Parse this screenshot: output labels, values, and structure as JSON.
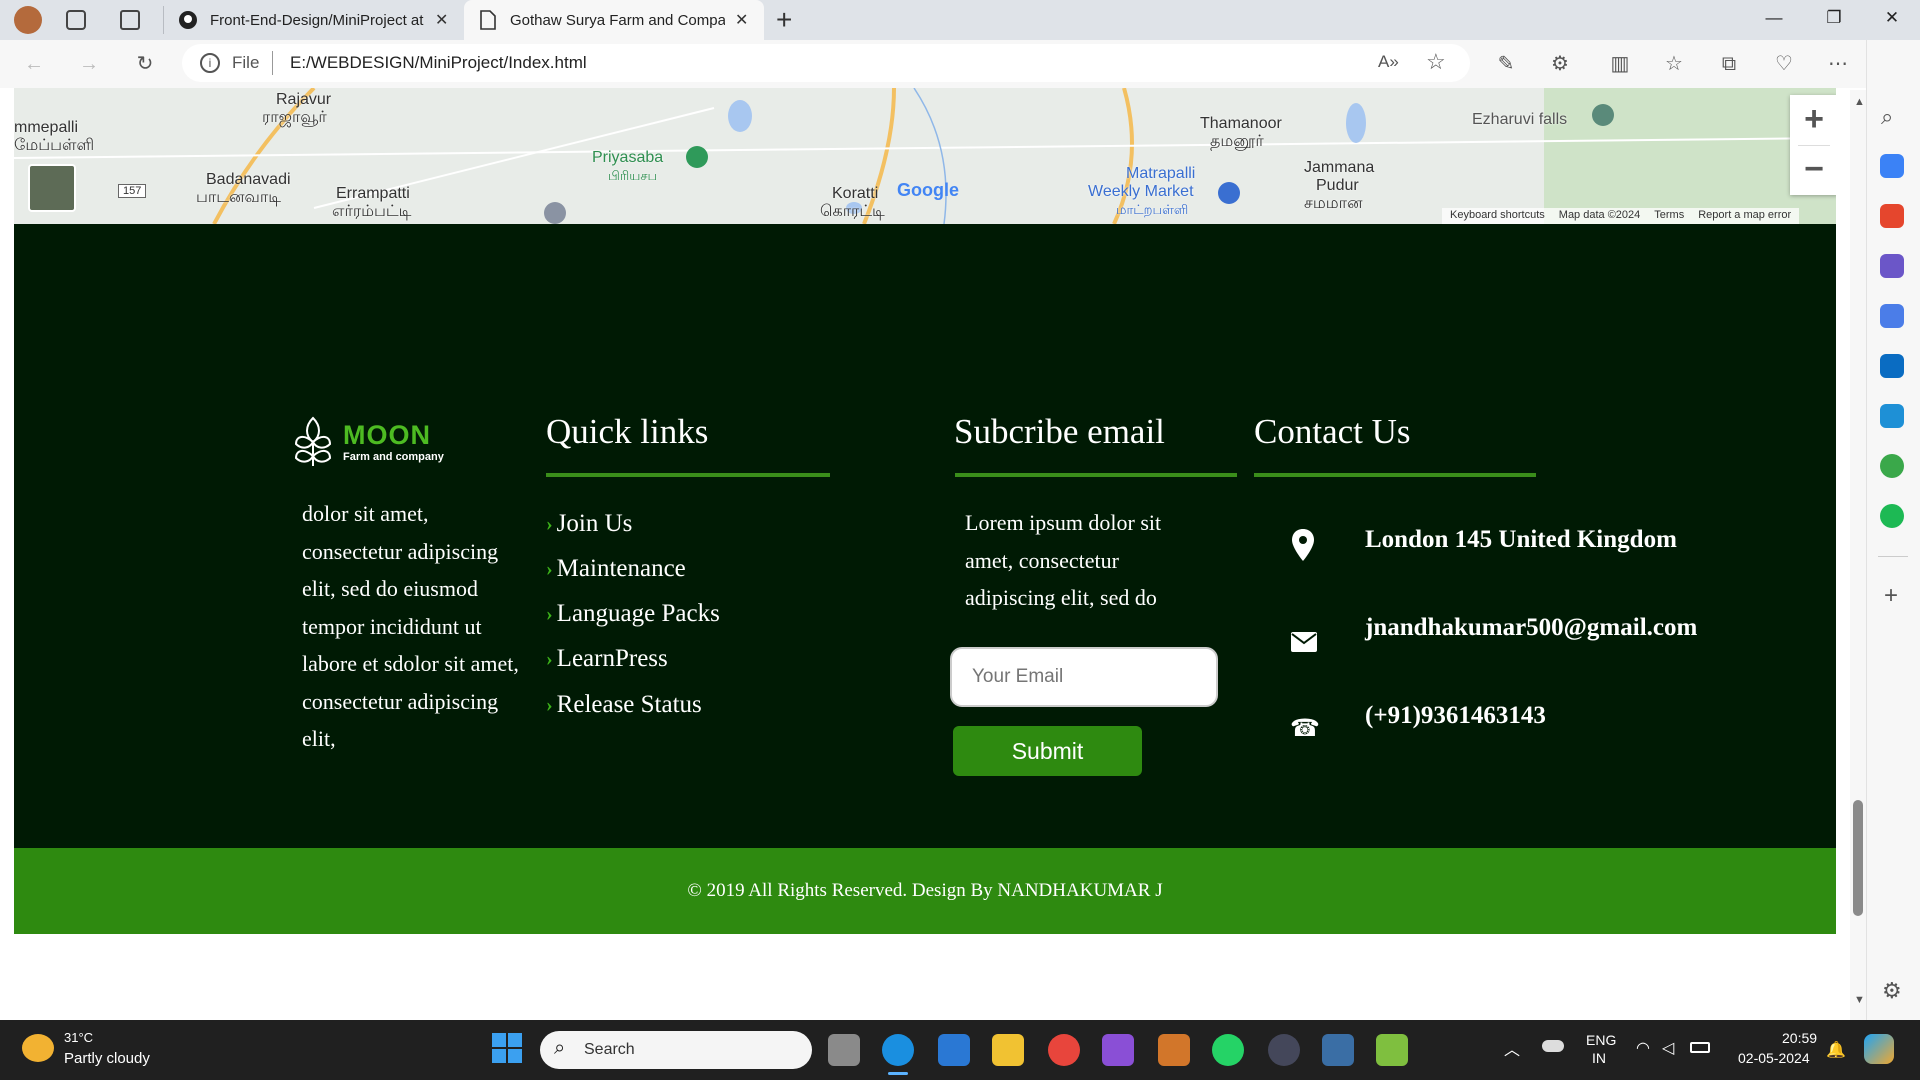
{
  "browser": {
    "tabs": [
      {
        "title": "Front-End-Design/MiniProject at",
        "active": false
      },
      {
        "title": "Gothaw Surya Farm and Compan",
        "active": true
      }
    ],
    "new_tab_label": "+",
    "url_scheme_label": "File",
    "url": "E:/WEBDESIGN/MiniProject/Index.html"
  },
  "map": {
    "labels": [
      {
        "text": "Rajavur"
      },
      {
        "text": "ராஜாவூர்"
      },
      {
        "text": "mmepalli"
      },
      {
        "text": "மேப்பள்ளி"
      },
      {
        "text": "Badanavadi"
      },
      {
        "text": "பாடனவாடி"
      },
      {
        "text": "Errampatti"
      },
      {
        "text": "எர்ரம்பட்டி"
      },
      {
        "text": "Priyasaba"
      },
      {
        "text": "பிரியசப"
      },
      {
        "text": "Koratti"
      },
      {
        "text": "கொரட்டி"
      },
      {
        "text": "Thamanoor"
      },
      {
        "text": "தமனூர்"
      },
      {
        "text": "Matrapalli"
      },
      {
        "text": "Weekly Market"
      },
      {
        "text": "மாட்றபள்ளி"
      },
      {
        "text": "Jammana"
      },
      {
        "text": "Pudur"
      },
      {
        "text": "சமமான"
      },
      {
        "text": "Ezharuvi falls"
      }
    ],
    "road_number": "157",
    "google_logo": "Google",
    "attribution": [
      "Keyboard shortcuts",
      "Map data ©2024",
      "Terms",
      "Report a map error"
    ],
    "zoom_in": "+",
    "zoom_out": "−"
  },
  "footer": {
    "logo_title": "MOON",
    "logo_subtitle": "Farm and company",
    "about_text": [
      "dolor sit amet,",
      "consectetur adipiscing",
      "elit, sed do eiusmod",
      "tempor incididunt ut",
      "labore et sdolor sit amet,",
      "consectetur adipiscing",
      "elit,"
    ],
    "quick_links_heading": "Quick links",
    "quick_links": [
      "Join Us",
      "Maintenance",
      "Language Packs",
      "LearnPress",
      "Release Status"
    ],
    "subscribe_heading": "Subcribe email",
    "subscribe_text": [
      "Lorem ipsum dolor sit",
      "amet, consectetur",
      "adipiscing elit, sed do"
    ],
    "email_placeholder": "Your Email",
    "submit_label": "Submit",
    "contact_heading": "Contact Us",
    "contact": {
      "address": "London 145 United Kingdom",
      "email": "jnandhakumar500@gmail.com",
      "phone": "(+91)9361463143"
    },
    "copyright": "© 2019 All Rights Reserved. Design By  NANDHAKUMAR J"
  },
  "taskbar": {
    "weather_temp": "31°C",
    "weather_desc": "Partly cloudy",
    "search_placeholder": "Search",
    "lang_top": "ENG",
    "lang_bottom": "IN",
    "time": "20:59",
    "date": "02-05-2024"
  },
  "colors": {
    "footer_bg": "#001a04",
    "accent_green": "#2e8a10",
    "logo_green": "#4dbb22"
  }
}
